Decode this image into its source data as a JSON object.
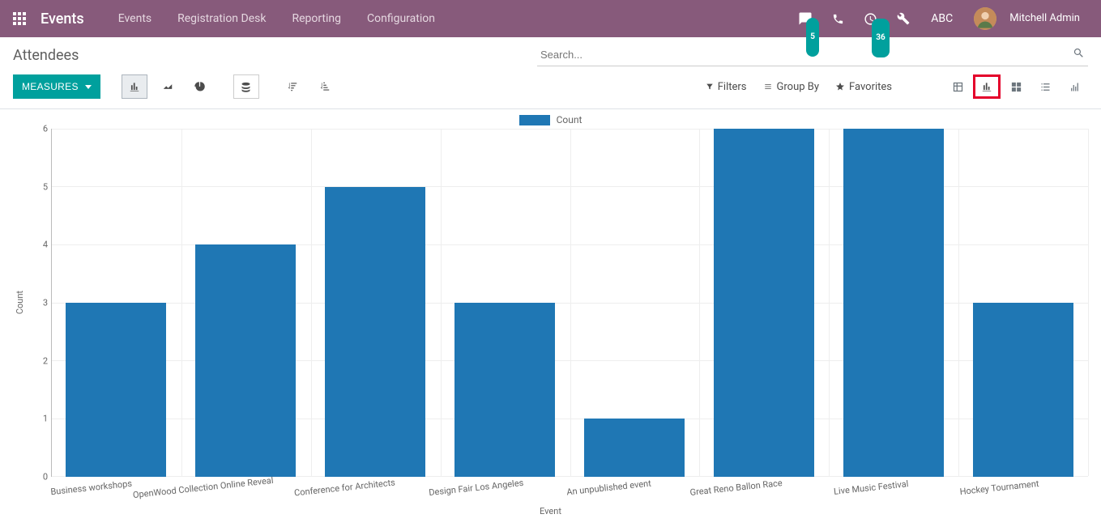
{
  "navbar": {
    "brand": "Events",
    "menu": [
      "Events",
      "Registration Desk",
      "Reporting",
      "Configuration"
    ],
    "messaging_badge": "5",
    "activities_badge": "36",
    "company": "ABC",
    "user": "Mitchell Admin"
  },
  "breadcrumb": "Attendees",
  "search": {
    "placeholder": "Search..."
  },
  "toolbar": {
    "measures": "MEASURES"
  },
  "filters": {
    "filters_label": "Filters",
    "groupby_label": "Group By",
    "favorites_label": "Favorites"
  },
  "chart_data": {
    "type": "bar",
    "title": "",
    "legend": "Count",
    "xlabel": "Event",
    "ylabel": "Count",
    "ylim": [
      0,
      6
    ],
    "yticks": [
      0,
      1,
      2,
      3,
      4,
      5,
      6
    ],
    "categories": [
      "Business workshops",
      "OpenWood Collection Online Reveal",
      "Conference for Architects",
      "Design Fair Los Angeles",
      "An unpublished event",
      "Great Reno Ballon Race",
      "Live Music Festival",
      "Hockey Tournament"
    ],
    "values": [
      3,
      4,
      5,
      3,
      1,
      6,
      6,
      3
    ]
  }
}
